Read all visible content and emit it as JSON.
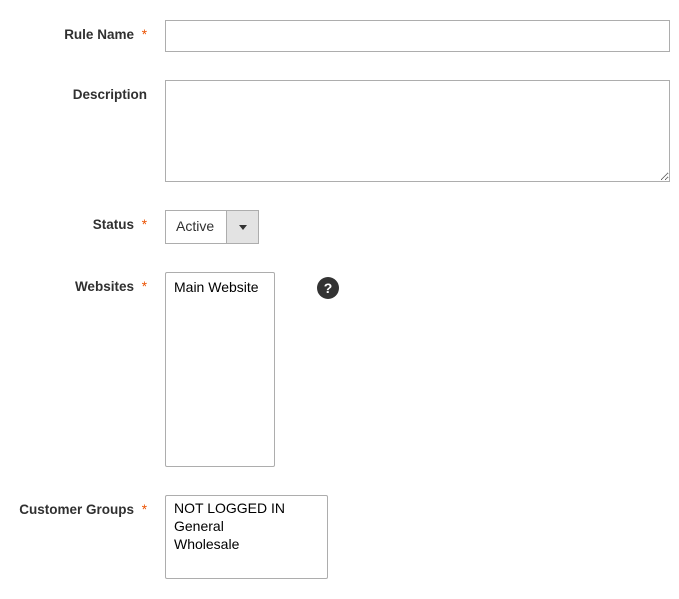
{
  "fields": {
    "rule_name": {
      "label": "Rule Name",
      "value": "",
      "required": true
    },
    "description": {
      "label": "Description",
      "value": "",
      "required": false
    },
    "status": {
      "label": "Status",
      "value": "Active",
      "required": true
    },
    "websites": {
      "label": "Websites",
      "required": true,
      "options": [
        "Main Website"
      ]
    },
    "customer_groups": {
      "label": "Customer Groups",
      "required": true,
      "options": [
        "NOT LOGGED IN",
        "General",
        "Wholesale"
      ]
    }
  },
  "required_mark": "*",
  "help_symbol": "?"
}
